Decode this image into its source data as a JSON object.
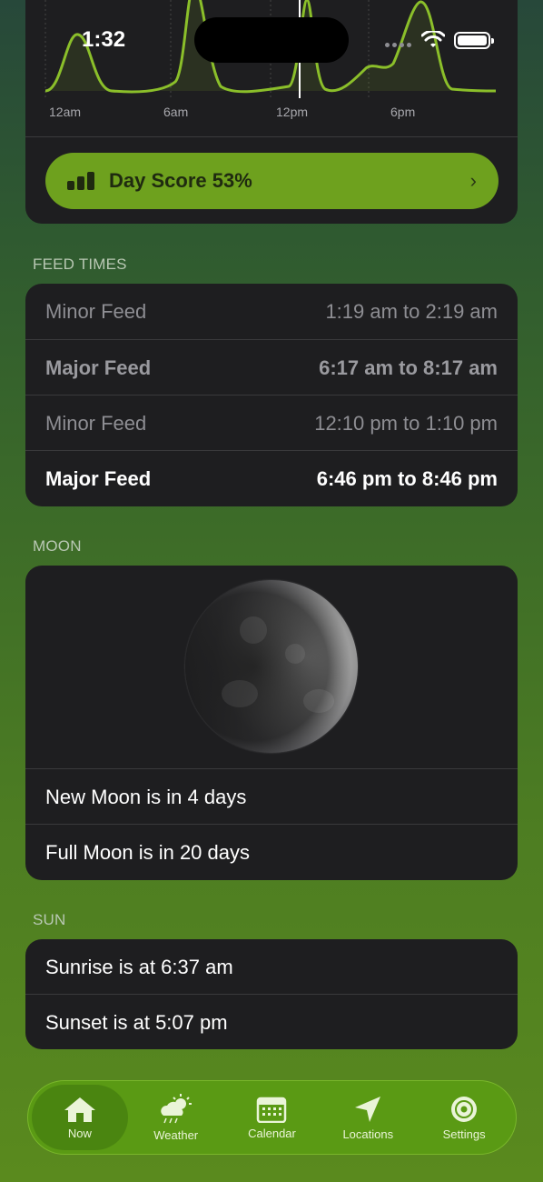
{
  "status_bar": {
    "time": "1:32"
  },
  "chart": {
    "ticks": [
      "12am",
      "6am",
      "12pm",
      "6pm"
    ],
    "line_color": "#8bbf2a"
  },
  "day_score": {
    "label": "Day Score 53%"
  },
  "feed_times": {
    "header": "FEED TIMES",
    "rows": [
      {
        "name": "Minor Feed",
        "time": "1:19 am to 2:19 am"
      },
      {
        "name": "Major Feed",
        "time": "6:17 am to 8:17 am"
      },
      {
        "name": "Minor Feed",
        "time": "12:10 pm to 1:10 pm"
      },
      {
        "name": "Major Feed",
        "time": "6:46 pm to 8:46 pm"
      }
    ]
  },
  "moon": {
    "header": "MOON",
    "new_moon": "New Moon is in 4 days",
    "full_moon": "Full Moon is in 20 days"
  },
  "sun": {
    "header": "SUN",
    "sunrise": "Sunrise is at 6:37 am",
    "sunset": "Sunset is at 5:07 pm"
  },
  "tabs": [
    {
      "label": "Now",
      "icon": "home-icon"
    },
    {
      "label": "Weather",
      "icon": "weather-icon"
    },
    {
      "label": "Calendar",
      "icon": "calendar-icon"
    },
    {
      "label": "Locations",
      "icon": "location-arrow-icon"
    },
    {
      "label": "Settings",
      "icon": "gear-icon"
    }
  ],
  "colors": {
    "accent": "#6ea11e",
    "card": "#1e1e20"
  }
}
